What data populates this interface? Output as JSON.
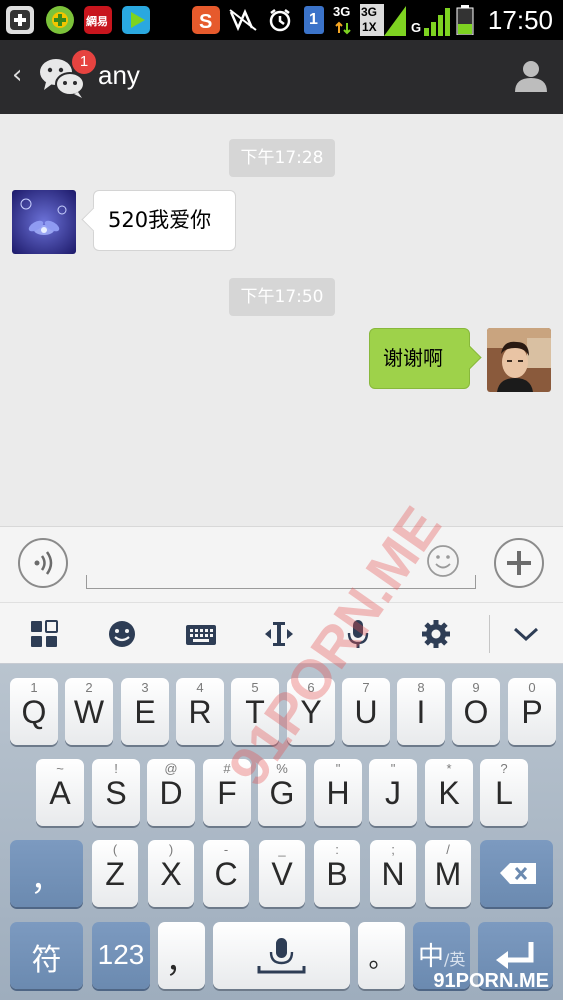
{
  "status_bar": {
    "time": "17:50",
    "network_a": "3G",
    "network_b": "3G",
    "network_b2": "1X",
    "g_label": "G",
    "sim_badge": "1",
    "app_icon_163": "網易"
  },
  "header": {
    "back_glyph": "‹",
    "chat_name": "any",
    "unread_badge": "1"
  },
  "chat": {
    "timestamp_1": "下午17:28",
    "message_in": "520我爱你",
    "timestamp_2": "下午17:50",
    "message_out": "谢谢啊"
  },
  "keyboard": {
    "row1": [
      {
        "sub": "1",
        "main": "Q"
      },
      {
        "sub": "2",
        "main": "W"
      },
      {
        "sub": "3",
        "main": "E"
      },
      {
        "sub": "4",
        "main": "R"
      },
      {
        "sub": "5",
        "main": "T"
      },
      {
        "sub": "6",
        "main": "Y"
      },
      {
        "sub": "7",
        "main": "U"
      },
      {
        "sub": "8",
        "main": "I"
      },
      {
        "sub": "9",
        "main": "O"
      },
      {
        "sub": "0",
        "main": "P"
      }
    ],
    "row2": [
      {
        "sub": "~",
        "main": "A"
      },
      {
        "sub": "!",
        "main": "S"
      },
      {
        "sub": "@",
        "main": "D"
      },
      {
        "sub": "#",
        "main": "F"
      },
      {
        "sub": "%",
        "main": "G"
      },
      {
        "sub": "\"",
        "main": "H"
      },
      {
        "sub": "\"",
        "main": "J"
      },
      {
        "sub": "*",
        "main": "K"
      },
      {
        "sub": "?",
        "main": "L"
      }
    ],
    "row3": [
      {
        "sub": "(",
        "main": "Z"
      },
      {
        "sub": ")",
        "main": "X"
      },
      {
        "sub": "-",
        "main": "C"
      },
      {
        "sub": "_",
        "main": "V"
      },
      {
        "sub": ":",
        "main": "B"
      },
      {
        "sub": ";",
        "main": "N"
      },
      {
        "sub": "/",
        "main": "M"
      }
    ],
    "comma_key": "，",
    "symbol_key": "符",
    "number_key": "123",
    "comma_key_2": "，",
    "period_key": "。",
    "lang_key_main": "中",
    "lang_key_sub": "/英"
  },
  "watermark": {
    "corner": "91PORN.ME",
    "diagonal": "91PORN.ME"
  },
  "colors": {
    "header_bg": "#2b2b2d",
    "chat_bg": "#ebebeb",
    "bubble_out": "#9ed24a",
    "badge": "#e64340",
    "keyboard_bg": "#b9c4cf",
    "dark_key": "#7c9ac0"
  }
}
